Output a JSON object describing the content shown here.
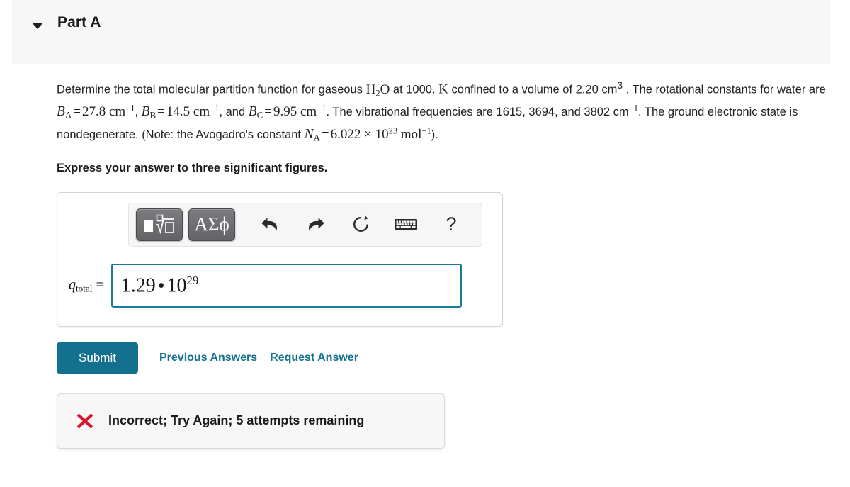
{
  "header": {
    "title": "Part A",
    "toggle_icon": "triangle-down-icon"
  },
  "question": {
    "line1_a": "Determine the total molecular partition function for gaseous ",
    "h2o_H": "H",
    "h2o_2": "2",
    "h2o_O": "O",
    "line1_b": " at 1000. ",
    "kelvin": "K",
    "line1_c": " confined to a volume of 2.20 cm",
    "vol_exp": "3",
    "line1_d": " . The rotational constants for water are ",
    "B": "B",
    "sub_A": "A",
    "eq": "=",
    "BA_val": "27.8 cm",
    "neg1": "−1",
    "comma1": ", ",
    "sub_B": "B",
    "BB_val": "14.5 cm",
    "comma2": ", and ",
    "sub_C": "C",
    "BC_val": "9.95 cm",
    "line2_tail": ". The vibrational frequencies are 1615, 3694, and 3802 cm",
    "line3_tail": ". The ground electronic state is nondegenerate. (Note: the Avogadro's constant ",
    "N": "N",
    "NA_val": "6.022",
    "times": "×",
    "ten": "10",
    "exp23": "23",
    "mol": " mol",
    "close_paren": ")."
  },
  "express_note": "Express your answer to three significant figures.",
  "toolbar": {
    "template_button": "math-template-button",
    "greek_label": "ΑΣϕ",
    "undo": "undo-icon",
    "redo": "redo-icon",
    "reset": "reset-icon",
    "keyboard": "keyboard-icon",
    "help_label": "?"
  },
  "answer": {
    "label_q": "q",
    "label_sub": "total",
    "label_eq": " =",
    "value_mantissa": "1.29",
    "value_dot": "•",
    "value_base": "10",
    "value_exponent": "29",
    "placeholder": ""
  },
  "actions": {
    "submit_label": "Submit",
    "previous_answers_label": "Previous Answers",
    "request_answer_label": "Request Answer"
  },
  "feedback": {
    "icon": "red-x-icon",
    "message": "Incorrect; Try Again; 5 attempts remaining"
  },
  "colors": {
    "accent_teal": "#13718f",
    "input_border": "#1b7a9c",
    "error_red": "#d8152a",
    "header_band": "#f7f7f7"
  }
}
